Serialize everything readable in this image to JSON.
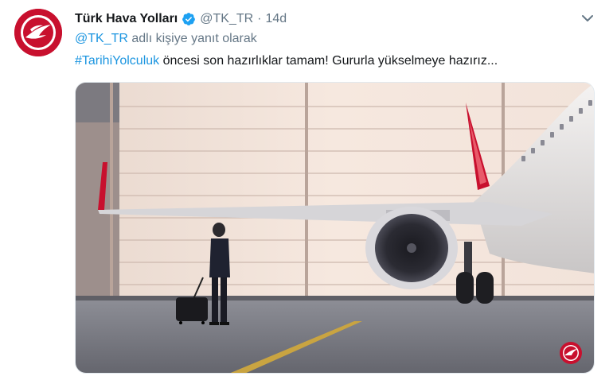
{
  "account": {
    "display_name": "Türk Hava Yolları",
    "handle": "@TK_TR",
    "time": "14d",
    "separator": "·",
    "verified": true,
    "avatar_icon": "turkish-airlines-logo",
    "brand_color": "#c8102e"
  },
  "reply": {
    "handle": "@TK_TR",
    "text": "adlı kişiye yanıt olarak"
  },
  "tweet": {
    "hashtag": "#TarihiYolculuk",
    "text": "öncesi son hazırlıklar tamam! Gururla yükselmeye hazırız..."
  },
  "media": {
    "description_icon": "hangar-airplane-photo",
    "watermark_icon": "turkish-airlines-logo"
  },
  "icons": {
    "verified": "verified-badge-icon",
    "menu": "chevron-down-icon"
  },
  "colors": {
    "link": "#1b95e0",
    "secondary_text": "#657786",
    "text": "#14171a"
  }
}
